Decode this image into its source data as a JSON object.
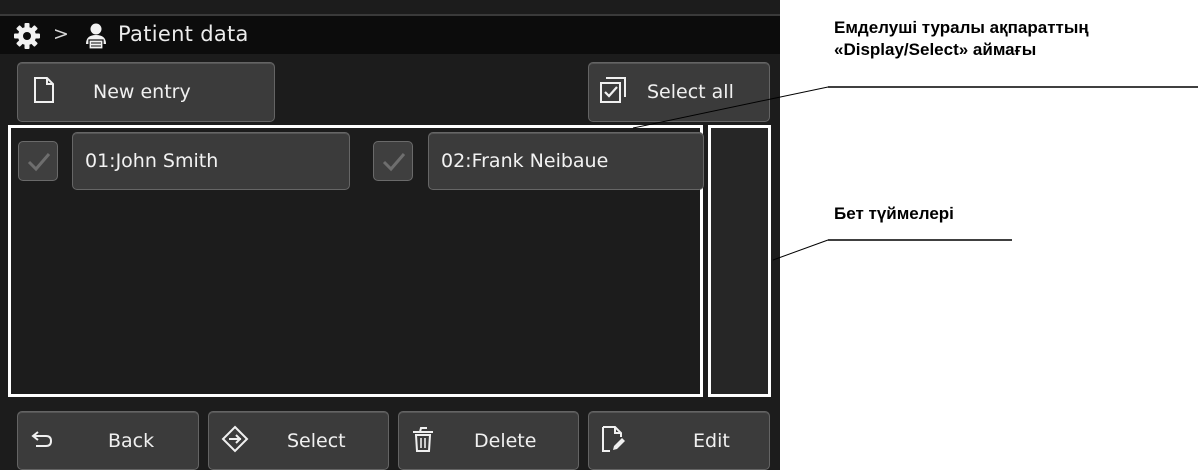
{
  "header": {
    "title": "Patient data",
    "separator": ">"
  },
  "toolbar": {
    "new_entry_label": "New entry",
    "select_all_label": "Select all"
  },
  "patients": [
    {
      "label": "01:John Smith",
      "checked": true
    },
    {
      "label": "02:Frank Neibaue",
      "checked": true
    }
  ],
  "footer": {
    "back_label": "Back",
    "select_label": "Select",
    "delete_label": "Delete",
    "edit_label": "Edit"
  },
  "annotations": {
    "display_select_line1": "Емделуші туралы ақпараттың",
    "display_select_line2": "«Display/Select» аймағы",
    "page_buttons": "Бет түймелері"
  },
  "colors": {
    "screen_bg": "#1c1c1c",
    "titlebar_bg": "#0c0c0c",
    "button_bg": "#3b3b3b",
    "highlight_border": "#ffffff",
    "text": "#f0f0f0"
  },
  "icons": [
    "gear-icon",
    "person-icon",
    "document-icon",
    "checkbox-select-all-icon",
    "checkmark-icon",
    "back-arrow-icon",
    "select-diamond-icon",
    "trash-icon",
    "edit-document-icon"
  ]
}
